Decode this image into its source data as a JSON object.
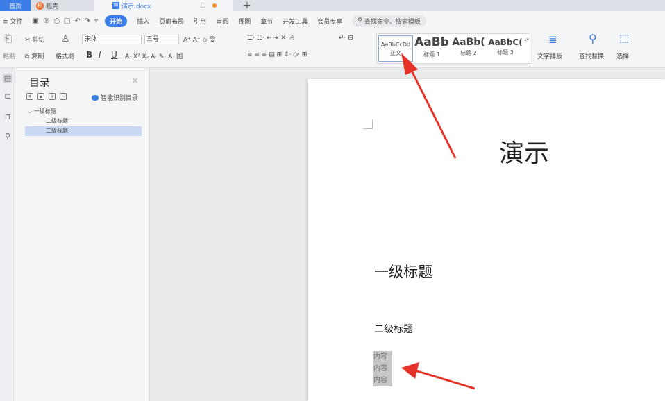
{
  "tabs": {
    "home": "首页",
    "docer": "稻壳",
    "document": "演示.docx",
    "new_tab": "+"
  },
  "menu": {
    "file": "≡ 文件",
    "items": [
      "插入",
      "页面布局",
      "引用",
      "审阅",
      "视图",
      "章节",
      "开发工具",
      "会员专享"
    ],
    "active": "开始",
    "search_placeholder": "查找命令、搜索模板"
  },
  "ribbon": {
    "paste": "粘贴",
    "cut": "剪切",
    "copy": "复制",
    "format_painter": "格式刷",
    "font_name": "宋体",
    "font_size": "五号",
    "bold": "B",
    "italic": "I",
    "underline": "U",
    "text_layout": "文字排版",
    "find_replace": "查找替换",
    "select": "选择",
    "styles": [
      {
        "preview": "AaBbCcDd",
        "name": "正文"
      },
      {
        "preview": "AaBb",
        "name": "标题 1"
      },
      {
        "preview": "AaBb(",
        "name": "标题 2"
      },
      {
        "preview": "AaBbC(",
        "name": "标题 3"
      }
    ]
  },
  "toc": {
    "title": "目录",
    "smart": "智能识别目录",
    "items": [
      {
        "label": "一级标题",
        "level": 1,
        "selected": false
      },
      {
        "label": "二级标题",
        "level": 2,
        "selected": false
      },
      {
        "label": "二级标题",
        "level": 2,
        "selected": true
      }
    ]
  },
  "document": {
    "title": "演示",
    "heading1": "一级标题",
    "heading2": "二级标题",
    "body_lines": [
      "内容",
      "内容",
      "内容"
    ]
  },
  "colors": {
    "accent": "#3c7ee8",
    "arrow": "#e5332a",
    "selection": "#c6c6c6"
  }
}
